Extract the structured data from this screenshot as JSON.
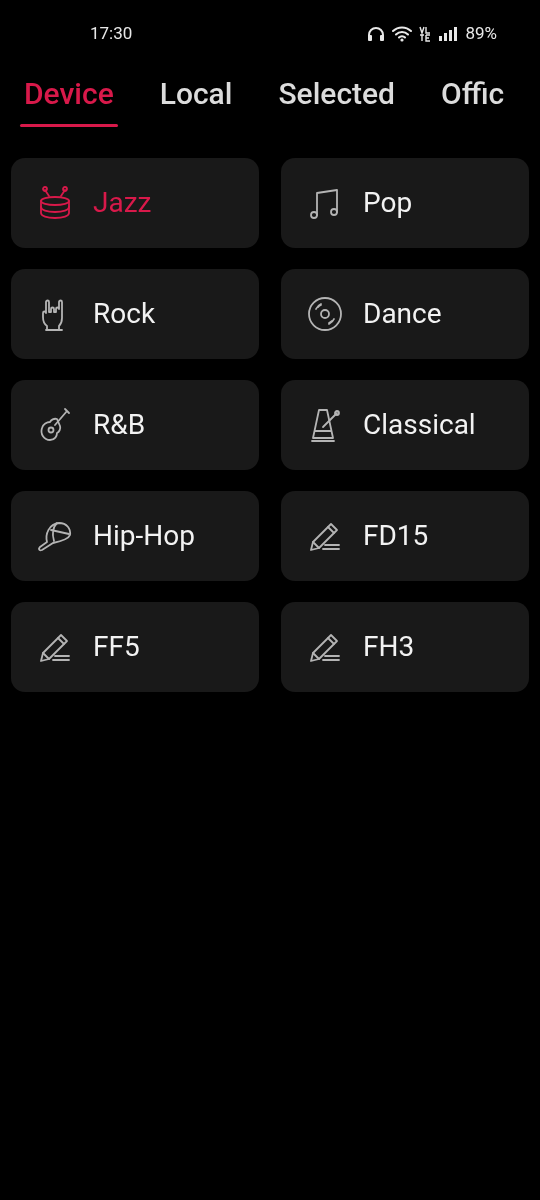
{
  "status_bar": {
    "time": "17:30",
    "battery": "89%"
  },
  "tabs": [
    {
      "label": "Device",
      "selected": true
    },
    {
      "label": "Local",
      "selected": false
    },
    {
      "label": "Selected",
      "selected": false
    },
    {
      "label": "Offic",
      "selected": false
    }
  ],
  "presets": [
    {
      "label": "Jazz",
      "kind": "drum",
      "selected": true
    },
    {
      "label": "Pop",
      "kind": "note",
      "selected": false
    },
    {
      "label": "Rock",
      "kind": "hand",
      "selected": false
    },
    {
      "label": "Dance",
      "kind": "disc",
      "selected": false
    },
    {
      "label": "R&B",
      "kind": "guitar",
      "selected": false
    },
    {
      "label": "Classical",
      "kind": "metronome",
      "selected": false
    },
    {
      "label": "Hip-Hop",
      "kind": "cap",
      "selected": false
    },
    {
      "label": "FD15",
      "kind": "custom",
      "selected": false
    },
    {
      "label": "FF5",
      "kind": "custom",
      "selected": false
    },
    {
      "label": "FH3",
      "kind": "custom",
      "selected": false
    }
  ]
}
